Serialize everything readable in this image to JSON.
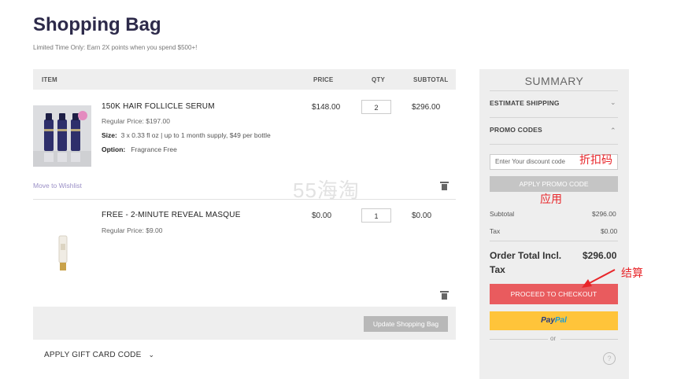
{
  "page": {
    "title": "Shopping Bag",
    "promo": "Limited Time Only: Earn 2X points when you spend $500+!"
  },
  "table": {
    "headers": {
      "item": "ITEM",
      "price": "PRICE",
      "qty": "QTY",
      "subtotal": "SUBTOTAL"
    },
    "items": [
      {
        "name": "150K HAIR FOLLICLE SERUM",
        "regular_price": "Regular Price: $197.00",
        "size_label": "Size:",
        "size_value": "3 x 0.33 fl oz | up to 1 month supply, $49 per bottle",
        "option_label": "Option:",
        "option_value": "Fragrance Free",
        "price": "$148.00",
        "qty": "2",
        "subtotal": "$296.00",
        "wishlist": "Move to Wishlist"
      },
      {
        "name": "FREE - 2-MINUTE REVEAL MASQUE",
        "regular_price": "Regular Price: $9.00",
        "price": "$0.00",
        "qty": "1",
        "subtotal": "$0.00"
      }
    ],
    "update_button": "Update Shopping Bag",
    "gift_card": "APPLY GIFT CARD CODE"
  },
  "summary": {
    "title": "SUMMARY",
    "estimate_shipping": "ESTIMATE SHIPPING",
    "promo_codes": "PROMO CODES",
    "discount_placeholder": "Enter Your discount code",
    "apply_button": "APPLY PROMO CODE",
    "subtotal_label": "Subtotal",
    "subtotal_value": "$296.00",
    "tax_label": "Tax",
    "tax_value": "$0.00",
    "total_label_line1": "Order Total Incl.",
    "total_label_line2": "Tax",
    "total_value": "$296.00",
    "checkout_button": "PROCEED TO CHECKOUT",
    "paypal_pay": "Pay",
    "paypal_pal": "Pal",
    "or": "or",
    "help": "?"
  },
  "annotations": {
    "discount_code": "折扣码",
    "apply": "应用",
    "checkout": "结算"
  },
  "watermark": "55海淘",
  "colors": {
    "title": "#2d2a4a",
    "checkout": "#e95b5e",
    "paypal": "#ffc43a",
    "paypal_dark": "#253b80",
    "paypal_light": "#179bd7",
    "annotation": "#e8262a",
    "wishlist": "#9a8fc6"
  },
  "icons": [
    "trash-icon",
    "chevron-down-icon",
    "chevron-up-icon",
    "help-icon",
    "arrow-annotation"
  ]
}
